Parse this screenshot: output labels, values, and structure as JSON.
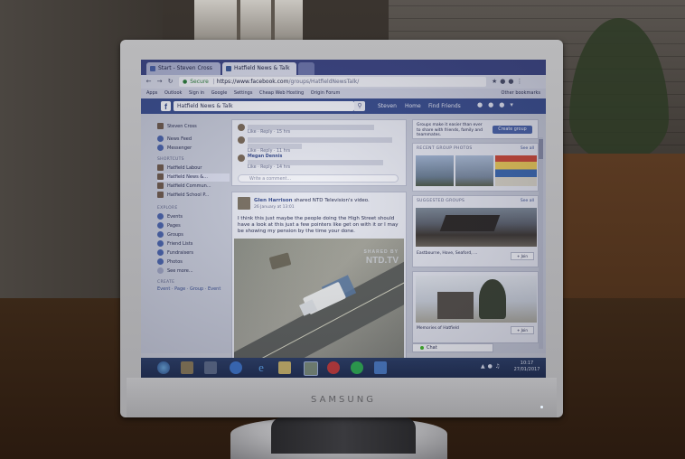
{
  "browser": {
    "tabs": [
      {
        "label": "Start - Steven Cross",
        "active": false
      },
      {
        "label": "Hatfield News & Talk",
        "active": true
      }
    ],
    "security_label": "Secure",
    "url_host": "https://www.facebook.com",
    "url_path": "/groups/HatfieldNewsTalk/",
    "bookmarks": [
      "Apps",
      "Outlook",
      "Sign in",
      "Google",
      "Settings",
      "Cheap Web Hosting",
      "Origin Forum"
    ],
    "other_bookmarks": "Other bookmarks"
  },
  "facebook": {
    "logo": "f",
    "search_value": "Hatfield News & Talk",
    "nav": {
      "user": "Steven",
      "home": "Home",
      "find_friends": "Find Friends"
    }
  },
  "left_nav": {
    "profile": "Steven Cross",
    "items": [
      "News Feed",
      "Messenger"
    ],
    "shortcuts_heading": "SHORTCUTS",
    "shortcuts": [
      "Hatfield Labour",
      "Hatfield News &...",
      "Hatfield Commun...",
      "Hatfield School P..."
    ],
    "explore_heading": "EXPLORE",
    "explore": [
      "Events",
      "Pages",
      "Groups",
      "Friend Lists",
      "Fundraisers",
      "Photos",
      "See more..."
    ],
    "create_heading": "CREATE",
    "create_links": "Event · Page · Group · Event"
  },
  "feed": {
    "comments": [
      {
        "name": "",
        "text": "",
        "meta": "Like · Reply · 15 hrs"
      },
      {
        "name": "",
        "text": "",
        "meta": "Like · Reply · 11 hrs"
      },
      {
        "name": "Megan Dennis",
        "text": "",
        "meta": "Like · Reply · 14 hrs"
      }
    ],
    "comment_placeholder": "Write a comment...",
    "post": {
      "author": "Glen Harrison",
      "action": "shared NTD Television's video.",
      "time": "26 January at 13:01",
      "text": "I think this just maybe the people doing the High Street should have a look at this just a few pointers like get on with it or I may be showing my pension by the time your done."
    },
    "video_brand": "NTD.TV",
    "video_brand_sub": "SHARED BY"
  },
  "right_col": {
    "create_group_text": "Groups make it easier than ever to share with friends, family and teammates.",
    "create_group_button": "Create group",
    "recent_photos_title": "RECENT GROUP PHOTOS",
    "see_all": "See all",
    "suggested_title": "SUGGESTED GROUPS",
    "suggested_1_caption": "Eastbourne, Hove, Seaford, ...",
    "suggested_2_caption": "Memories of Hatfield",
    "join_label": "+ Join"
  },
  "chat": {
    "label": "Chat"
  },
  "taskbar": {
    "clock_time": "10:17",
    "clock_date": "27/01/2017"
  },
  "monitor": {
    "brand": "SAMSUNG"
  },
  "colors": {
    "facebook_blue": "#3b4f8f",
    "chrome_tab": "#3d4785",
    "taskbar": "#1f2e52",
    "bezel": "#b9b9bb"
  }
}
